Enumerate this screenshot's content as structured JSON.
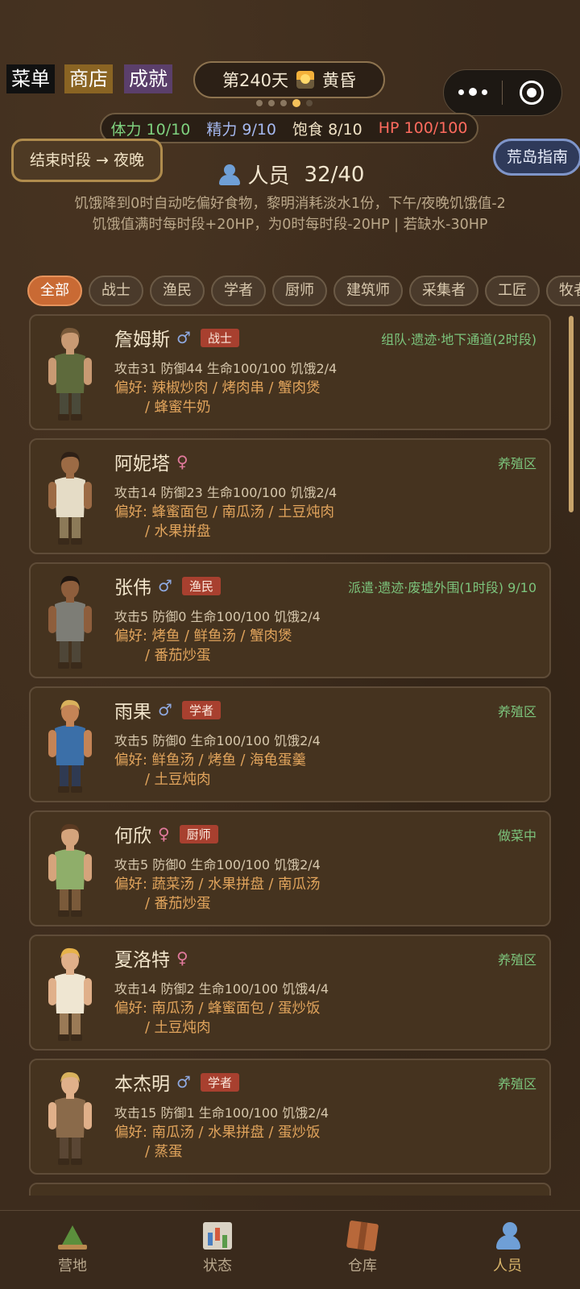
{
  "top_menu": {
    "menu": "菜单",
    "shop": "商店",
    "achievements": "成就"
  },
  "day": {
    "label": "第240天",
    "period": "黄昏"
  },
  "pager": {
    "count": 5,
    "active_index": 3
  },
  "stats_bar": {
    "stamina": "体力 10/10",
    "energy": "精力 9/10",
    "satiety": "饱食 8/10",
    "hp": "HP 100/100"
  },
  "end_phase_button": "结束时段 → 夜晚",
  "guide_button": "荒岛指南",
  "people": {
    "title": "人员",
    "count": "32/40"
  },
  "rules": {
    "line1": "饥饿降到0时自动吃偏好食物，黎明消耗淡水1份，下午/夜晚饥饿值-2",
    "line2": "饥饿值满时每时段+20HP，为0时每时段-20HP | 若缺水-30HP"
  },
  "filter_tabs": [
    "全部",
    "战士",
    "渔民",
    "学者",
    "厨师",
    "建筑师",
    "采集者",
    "工匠",
    "牧者"
  ],
  "characters": [
    {
      "name": "詹姆斯",
      "gender": "♂",
      "gclass": "g-m",
      "role": "战士",
      "location": "组队·遗迹·地下通道(2时段)",
      "stats": "攻击31  防御44  生命100/100  饥饿2/4",
      "pref1": "偏好: 辣椒炒肉 / 烤肉串 / 蟹肉煲",
      "pref2": "/ 蜂蜜牛奶",
      "skin": "#c99a73",
      "hair": "#7a5a3a",
      "shirt": "#5e6a3c",
      "pants": "#4a4a3a"
    },
    {
      "name": "阿妮塔",
      "gender": "♀",
      "gclass": "g-f",
      "role": "",
      "location": "养殖区",
      "stats": "攻击14  防御23  生命100/100  饥饿2/4",
      "pref1": "偏好: 蜂蜜面包 / 南瓜汤 / 土豆炖肉",
      "pref2": "/ 水果拼盘",
      "skin": "#9c6b45",
      "hair": "#2e2016",
      "shirt": "#e5dcc6",
      "pants": "#8c7a58"
    },
    {
      "name": "张伟",
      "gender": "♂",
      "gclass": "g-m",
      "role": "渔民",
      "location": "派遣·遗迹·废墟外围(1时段) 9/10",
      "stats": "攻击5  防御0  生命100/100  饥饿2/4",
      "pref1": "偏好: 烤鱼 / 鲜鱼汤 / 蟹肉煲",
      "pref2": "/ 番茄炒蛋",
      "skin": "#8e5e3c",
      "hair": "#1f1610",
      "shirt": "#7d7d76",
      "pants": "#4e4638"
    },
    {
      "name": "雨果",
      "gender": "♂",
      "gclass": "g-m",
      "role": "学者",
      "location": "养殖区",
      "stats": "攻击5  防御0  生命100/100  饥饿2/4",
      "pref1": "偏好: 鲜鱼汤 / 烤鱼 / 海龟蛋羹",
      "pref2": "/ 土豆炖肉",
      "skin": "#c48456",
      "hair": "#d9b25c",
      "shirt": "#3b6fa8",
      "pants": "#2f3a52"
    },
    {
      "name": "何欣",
      "gender": "♀",
      "gclass": "g-f",
      "role": "厨师",
      "location": "做菜中",
      "stats": "攻击5  防御0  生命100/100  饥饿2/4",
      "pref1": "偏好: 蔬菜汤 / 水果拼盘 / 南瓜汤",
      "pref2": "/ 番茄炒蛋",
      "skin": "#d5a47c",
      "hair": "#5a3a22",
      "shirt": "#8fae6a",
      "pants": "#7a5a3a"
    },
    {
      "name": "夏洛特",
      "gender": "♀",
      "gclass": "g-f",
      "role": "",
      "location": "养殖区",
      "stats": "攻击14  防御2  生命100/100  饥饿4/4",
      "pref1": "偏好: 南瓜汤 / 蜂蜜面包 / 蛋炒饭",
      "pref2": "/ 土豆炖肉",
      "skin": "#e0b08a",
      "hair": "#e6b24a",
      "shirt": "#efe6d2",
      "pants": "#9a7a56"
    },
    {
      "name": "本杰明",
      "gender": "♂",
      "gclass": "g-m",
      "role": "学者",
      "location": "养殖区",
      "stats": "攻击15  防御1  生命100/100  饥饿2/4",
      "pref1": "偏好: 南瓜汤 / 水果拼盘 / 蛋炒饭",
      "pref2": "/ 蒸蛋",
      "skin": "#e0b08a",
      "hair": "#d9b25c",
      "shirt": "#8a6a4a",
      "pants": "#5a4634"
    }
  ],
  "bottom_nav": [
    {
      "label": "营地",
      "icon": "camp-icon"
    },
    {
      "label": "状态",
      "icon": "status-icon"
    },
    {
      "label": "仓库",
      "icon": "warehouse-icon"
    },
    {
      "label": "人员",
      "icon": "people-icon"
    }
  ],
  "colors": {
    "background": "#3d2c1d",
    "accent": "#c96a34",
    "location_green": "#7cc47c",
    "preference_orange": "#e1a45c",
    "role_badge": "#a8402f"
  }
}
